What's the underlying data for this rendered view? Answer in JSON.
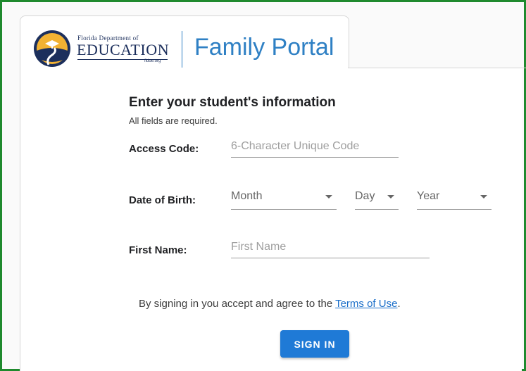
{
  "header": {
    "org_line1": "Florida Department of",
    "org_line2": "EDUCATION",
    "org_url": "fldoe.org",
    "portal_title": "Family Portal"
  },
  "form": {
    "heading": "Enter your student's information",
    "subheading": "All fields are required.",
    "access_code": {
      "label": "Access Code:",
      "placeholder": "6-Character Unique Code"
    },
    "dob": {
      "label": "Date of Birth:",
      "month_placeholder": "Month",
      "day_placeholder": "Day",
      "year_placeholder": "Year"
    },
    "first_name": {
      "label": "First Name:",
      "placeholder": "First Name"
    },
    "terms_prefix": "By signing in you accept and agree to the ",
    "terms_link": "Terms of Use",
    "terms_suffix": ".",
    "submit_label": "SIGN IN"
  },
  "icons": {
    "logo": "fldoe-seal-icon",
    "dropdown": "chevron-down-icon"
  },
  "colors": {
    "accent": "#1f7ad6",
    "title_blue": "#2f80c4",
    "frame_green": "#1f8a2e",
    "navy": "#1c2f5c"
  }
}
